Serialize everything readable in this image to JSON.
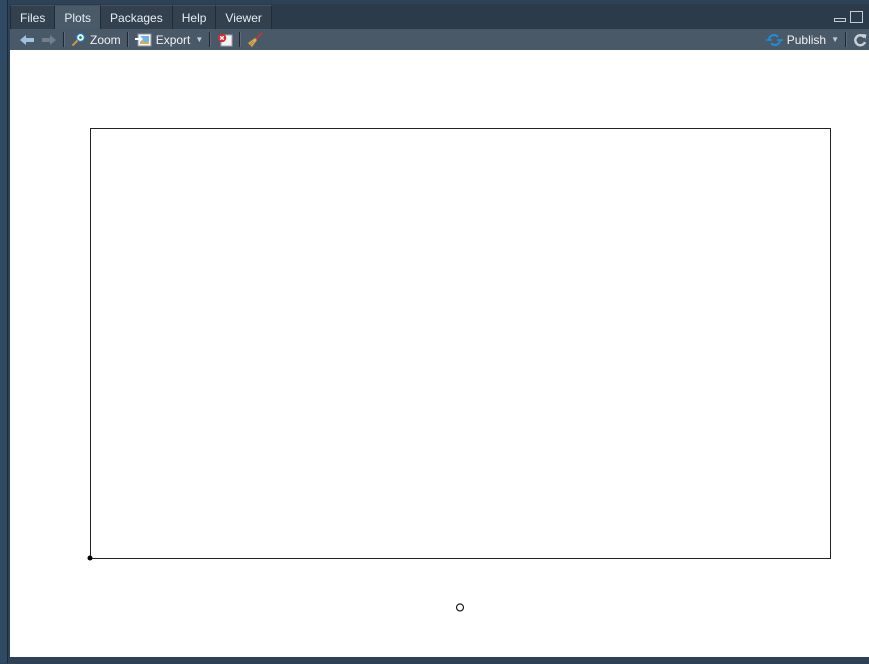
{
  "tabs": [
    {
      "label": "Files",
      "active": false
    },
    {
      "label": "Plots",
      "active": true
    },
    {
      "label": "Packages",
      "active": false
    },
    {
      "label": "Help",
      "active": false
    },
    {
      "label": "Viewer",
      "active": false
    }
  ],
  "toolbar": {
    "back_icon": "arrow-left-icon",
    "forward_icon": "arrow-right-icon",
    "zoom_label": "Zoom",
    "export_label": "Export",
    "remove_icon": "remove-plot-icon",
    "clear_icon": "broom-icon",
    "publish_label": "Publish",
    "refresh_icon": "refresh-icon"
  },
  "colors": {
    "accent_publish": "#1f8fd6",
    "pane_bg": "#ffffff",
    "chrome_bg": "#2d4257"
  },
  "chart_data": {
    "type": "scatter",
    "title": "",
    "xlabel": "",
    "ylabel": "",
    "grid": false,
    "axes_drawn": false,
    "box": true,
    "points": [
      {
        "x": 0,
        "y": 0,
        "marker": "filled-circle"
      },
      {
        "x": 0.5,
        "y": -0.115,
        "marker": "open-circle"
      }
    ],
    "xlim": [
      0,
      1
    ],
    "ylim": [
      0,
      1
    ]
  }
}
